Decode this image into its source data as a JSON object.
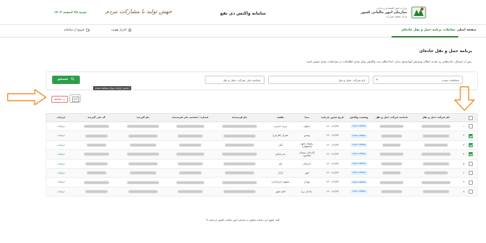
{
  "header": {
    "org_line1": "وزارت امور اقتصادی و دارایی",
    "org_line2": "سازمان امور مالیاتی کشور",
    "org_line3": "مرکز تنظیم مقررات",
    "system_title": "سامانه واکنش ذی نفع",
    "calligraphy": "جهش تولید با مشارکت مردم",
    "date": "شنبه ۲۵ اسفند ۱۴۰۳"
  },
  "nav": {
    "home": "صفحه اصلی",
    "active_tab": "معاملات برنامه حمل و نقل جاده‌ای",
    "identity": "احراز هویت",
    "logout": "خروج از سامانه"
  },
  "page": {
    "title": "برنامه حمل و نقل جاده‌ای",
    "notice": "پس از ارسال، جاده‌هایی رد شدند امکان ویرایش آنها وجود ندارد. اما امکان ثبت واکنش برای سایر اطلاعات در مراجعات بعدی میسر است."
  },
  "filters": {
    "status_value": "مشاهده نشده",
    "company_name_placeholder": "نام شرکت حمل و نقل",
    "company_id_placeholder": "شناسه ملی شرکت حمل و نقل",
    "search_label": "جستجو"
  },
  "actions": {
    "tooltip": "نمایش جزئیات موارد مشاهده نشده",
    "reject_label": "رد معامله"
  },
  "table": {
    "headers": [
      "",
      "",
      "نام شرکت حمل و نقل",
      "شناسه شرکت حمل و نقل",
      "وضعیت واکنش",
      "تاریخ صدور بارنامه",
      "مبدا",
      "مقصد",
      "نام فرستنده",
      "شماره / شناسه ملی فرستنده",
      "نام گیرنده",
      "کد ملی گیرنده",
      "جزئیات"
    ],
    "rows": [
      {
        "num": "۱",
        "checked": false,
        "status": "مشاهده نشده",
        "date": "۱۴۰۰/۱۲/۲۴",
        "origin": "دزفول",
        "destination": "تربت حیدریه",
        "details": "جزئیات"
      },
      {
        "num": "۲",
        "checked": true,
        "status": "مشاهده نشده",
        "date": "۱۴۰۰/۱۲/۲۴",
        "origin": "ونیس",
        "destination": "شیراز (فارس)",
        "details": "جزئیات"
      },
      {
        "num": "۳",
        "checked": true,
        "status": "مشاهده نشده",
        "date": "۱۴۰۰/۱۲/۲۴",
        "origin": "رضوان شهر (اصفهان)",
        "destination": "آمل",
        "details": "جزئیات"
      },
      {
        "num": "۴",
        "checked": true,
        "status": "مشاهده نشده",
        "date": "۱۴۰۰/۱۲/۲۴",
        "origin": "کارخانه سیمان شاهرود",
        "destination": "بندرعباس",
        "details": "جزئیات"
      },
      {
        "num": "۵",
        "checked": false,
        "status": "مشاهده نشده",
        "date": "۱۴۰۰/۱۲/۲۴",
        "origin": "داریجان",
        "destination": "قم",
        "details": "جزئیات"
      },
      {
        "num": "۶",
        "checked": false,
        "status": "مشاهده نشده",
        "date": "۱۴۰۰/۱۲/۲۴",
        "origin": "ابهر",
        "destination": "اراک",
        "details": "جزئیات"
      },
      {
        "num": "۷",
        "checked": false,
        "status": "مشاهده نشده",
        "date": "۱۴۰۰/۱۲/۲۴",
        "origin": "تهران",
        "destination": "مشهد (خراسان)",
        "details": "جزئیات"
      },
      {
        "num": "۸",
        "checked": false,
        "status": "مشاهده نشده",
        "date": "۱۴۰۰/۱۲/۲۴",
        "origin": "ساحل برج",
        "destination": "قایم شهر",
        "details": "جزئیات"
      }
    ]
  },
  "footer": "© کلیه حقوق این سامانه متعلق به سازمان امور مالیاتی کشور می‌باشد.",
  "colors": {
    "primary_green": "#2e9e48",
    "link_blue": "#1976d2",
    "danger_red": "#d32f2f",
    "arrow_orange": "#f28c28"
  }
}
